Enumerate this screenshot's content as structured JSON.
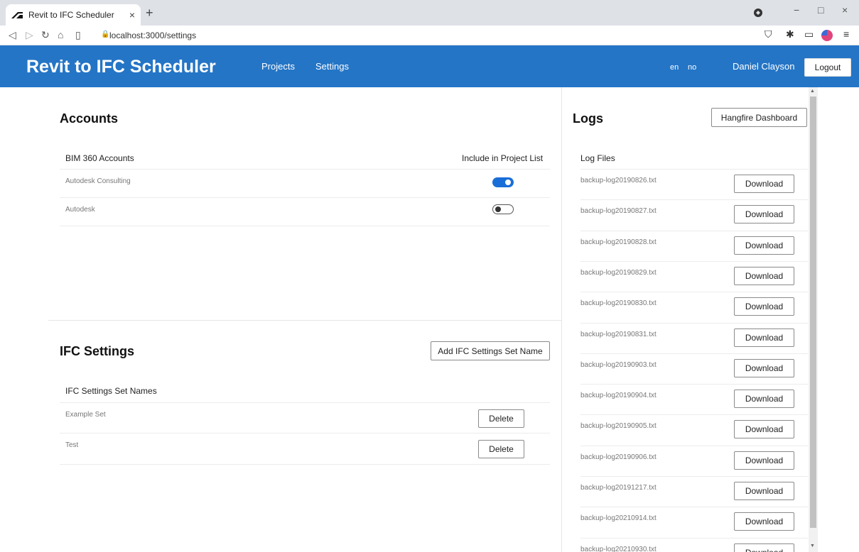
{
  "browser": {
    "tab_title": "Revit to IFC Scheduler",
    "tab_close": "×",
    "new_tab": "+",
    "url": "localhost:3000/settings",
    "window_controls": [
      "−",
      "□",
      "×"
    ]
  },
  "header": {
    "brand": "Revit to IFC Scheduler",
    "nav": [
      "Projects",
      "Settings"
    ],
    "languages": [
      "en",
      "no"
    ],
    "user_name": "Daniel Clayson",
    "logout_label": "Logout",
    "bg_color": "#2475c6"
  },
  "accounts": {
    "title": "Accounts",
    "col_name": "BIM 360 Accounts",
    "col_include": "Include in Project List",
    "rows": [
      {
        "name": "Autodesk Consulting",
        "included": true
      },
      {
        "name": "Autodesk",
        "included": false
      }
    ]
  },
  "ifc_settings": {
    "title": "IFC Settings",
    "add_button": "Add IFC Settings Set Name",
    "col_name": "IFC Settings Set Names",
    "rows": [
      {
        "name": "Example Set",
        "delete_label": "Delete"
      },
      {
        "name": "Test",
        "delete_label": "Delete"
      }
    ]
  },
  "logs": {
    "title": "Logs",
    "dashboard_button": "Hangfire Dashboard",
    "col_name": "Log Files",
    "download_label": "Download",
    "files": [
      "backup-log20190826.txt",
      "backup-log20190827.txt",
      "backup-log20190828.txt",
      "backup-log20190829.txt",
      "backup-log20190830.txt",
      "backup-log20190831.txt",
      "backup-log20190903.txt",
      "backup-log20190904.txt",
      "backup-log20190905.txt",
      "backup-log20190906.txt",
      "backup-log20191217.txt",
      "backup-log20210914.txt",
      "backup-log20210930.txt"
    ]
  }
}
